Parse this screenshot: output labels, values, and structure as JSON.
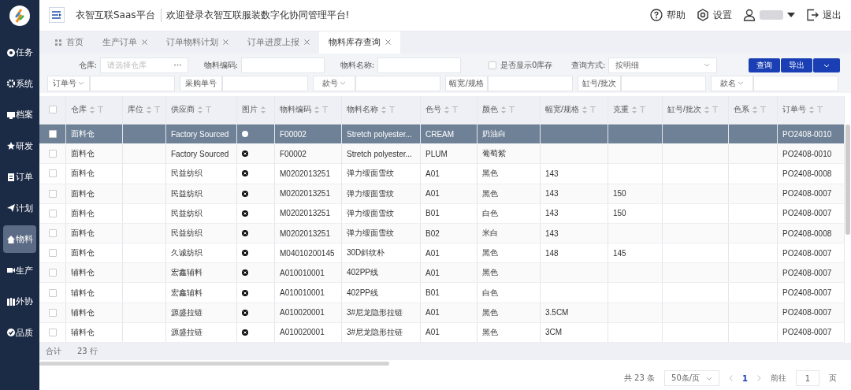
{
  "header": {
    "title": "衣智互联Saas平台",
    "welcome": "欢迎登录衣智互联服装数字化协同管理平台!",
    "actions": [
      {
        "kind": "help",
        "label": "帮助"
      },
      {
        "kind": "settings",
        "label": "设置"
      },
      {
        "kind": "user"
      },
      {
        "kind": "logout",
        "label": "退出"
      }
    ]
  },
  "sidebar": {
    "items": [
      {
        "label": "任务",
        "selected": false
      },
      {
        "label": "系统",
        "selected": false
      },
      {
        "label": "档案",
        "selected": false
      },
      {
        "label": "研发",
        "selected": false
      },
      {
        "label": "订单",
        "selected": false
      },
      {
        "label": "计划",
        "selected": false
      },
      {
        "label": "物料",
        "selected": true
      },
      {
        "label": "生产",
        "selected": false
      },
      {
        "label": "外协",
        "selected": false
      },
      {
        "label": "品质",
        "selected": false
      }
    ]
  },
  "tabs": [
    {
      "label": "首页",
      "selected": false,
      "closable": false
    },
    {
      "label": "生产订单",
      "selected": false,
      "closable": true
    },
    {
      "label": "订单物料计划",
      "selected": false,
      "closable": true
    },
    {
      "label": "订单进度上报",
      "selected": false,
      "closable": true
    },
    {
      "label": "物料库存查询",
      "selected": true,
      "closable": true
    }
  ],
  "filters": {
    "row_1": [
      {
        "kind": "field",
        "label": "仓库:",
        "placeholder": "请选择仓库",
        "picker": true
      },
      {
        "kind": "field",
        "label": "物料编码:",
        "picker": false
      },
      {
        "kind": "field",
        "label": "物料名称:",
        "picker": false
      },
      {
        "kind": "checkbox",
        "label": "是否显示0库存",
        "checked": false
      },
      {
        "kind": "select",
        "label": "查询方式:",
        "value": "按明细"
      }
    ],
    "row_2": [
      {
        "label": "订单号",
        "dropdown": true
      },
      {
        "label": "采购单号",
        "dropdown": false
      },
      {
        "label": "款号",
        "dropdown": true
      },
      {
        "label": "幅宽/规格",
        "dropdown": false
      },
      {
        "label": "缸号/批次",
        "dropdown": false
      },
      {
        "label": "款名",
        "dropdown": true
      }
    ],
    "buttons": [
      "查询",
      "导出"
    ]
  },
  "table": {
    "select_all": {
      "checked": false
    },
    "columns": [
      {
        "label": "仓库",
        "filter": true
      },
      {
        "label": "库位",
        "filter": true
      },
      {
        "label": "供应商",
        "filter": true
      },
      {
        "label": "图片",
        "filter": false
      },
      {
        "label": "物料编码",
        "filter": true
      },
      {
        "label": "物料名称",
        "filter": true
      },
      {
        "label": "色号",
        "filter": true
      },
      {
        "label": "颜色",
        "filter": true
      },
      {
        "label": "幅宽/规格",
        "filter": true
      },
      {
        "label": "克重",
        "filter": true
      },
      {
        "label": "缸号/批次",
        "filter": true
      },
      {
        "label": "色系",
        "filter": true
      },
      {
        "label": "订单号",
        "filter": true
      }
    ],
    "rows": [
      {
        "selected": true,
        "checked": false,
        "cells": [
          "面料仓",
          "",
          "Factory Sourced",
          "",
          "F00002",
          "Stretch polyester...",
          "CREAM",
          "奶油白",
          "",
          "",
          "",
          "",
          "PO2408-0010"
        ]
      },
      {
        "selected": false,
        "checked": false,
        "cells": [
          "面料仓",
          "",
          "Factory Sourced",
          "",
          "F00002",
          "Stretch polyester...",
          "PLUM",
          "葡萄紫",
          "",
          "",
          "",
          "",
          "PO2408-0010"
        ]
      },
      {
        "selected": false,
        "checked": false,
        "cells": [
          "面料仓",
          "",
          "民益纺织",
          "",
          "M0202013251",
          "弹力缎面雪纹",
          "A01",
          "黑色",
          "143",
          "",
          "",
          "",
          "PO2408-0008"
        ]
      },
      {
        "selected": false,
        "checked": false,
        "cells": [
          "面料仓",
          "",
          "民益纺织",
          "",
          "M0202013251",
          "弹力缎面雪纹",
          "A01",
          "黑色",
          "143",
          "150",
          "",
          "",
          "PO2408-0007"
        ]
      },
      {
        "selected": false,
        "checked": false,
        "cells": [
          "面料仓",
          "",
          "民益纺织",
          "",
          "M0202013251",
          "弹力缎面雪纹",
          "B01",
          "白色",
          "143",
          "150",
          "",
          "",
          "PO2408-0007"
        ]
      },
      {
        "selected": false,
        "checked": false,
        "cells": [
          "面料仓",
          "",
          "民益纺织",
          "",
          "M0202013251",
          "弹力缎面雪纹",
          "B02",
          "米白",
          "143",
          "",
          "",
          "",
          "PO2408-0008"
        ]
      },
      {
        "selected": false,
        "checked": false,
        "cells": [
          "面料仓",
          "",
          "久诚纺织",
          "",
          "M04010200145",
          "30D斜纹朴",
          "A01",
          "黑色",
          "148",
          "145",
          "",
          "",
          "PO2408-0007"
        ]
      },
      {
        "selected": false,
        "checked": false,
        "cells": [
          "辅料仓",
          "",
          "宏鑫辅料",
          "",
          "A010010001",
          "402PP线",
          "A01",
          "黑色",
          "",
          "",
          "",
          "",
          "PO2408-0007"
        ]
      },
      {
        "selected": false,
        "checked": false,
        "cells": [
          "辅料仓",
          "",
          "宏鑫辅料",
          "",
          "A010010001",
          "402PP线",
          "B01",
          "白色",
          "",
          "",
          "",
          "",
          "PO2408-0007"
        ]
      },
      {
        "selected": false,
        "checked": false,
        "cells": [
          "辅料仓",
          "",
          "源盛拉链",
          "",
          "A010020001",
          "3#尼龙隐形拉链",
          "A01",
          "黑色",
          "3.5CM",
          "",
          "",
          "",
          "PO2408-0007"
        ]
      },
      {
        "selected": false,
        "checked": false,
        "cells": [
          "辅料仓",
          "",
          "源盛拉链",
          "",
          "A010020001",
          "3#尼龙隐形拉链",
          "A01",
          "黑色",
          "3CM",
          "",
          "",
          "",
          "PO2408-0007"
        ]
      }
    ],
    "summary": {
      "label": "合计",
      "value": "23 行"
    }
  },
  "pagination": {
    "total": "共 23 条",
    "page_size": "50条/页",
    "current_page": "1",
    "goto_label": "前往",
    "goto_value": "1",
    "page_unit": "页"
  }
}
